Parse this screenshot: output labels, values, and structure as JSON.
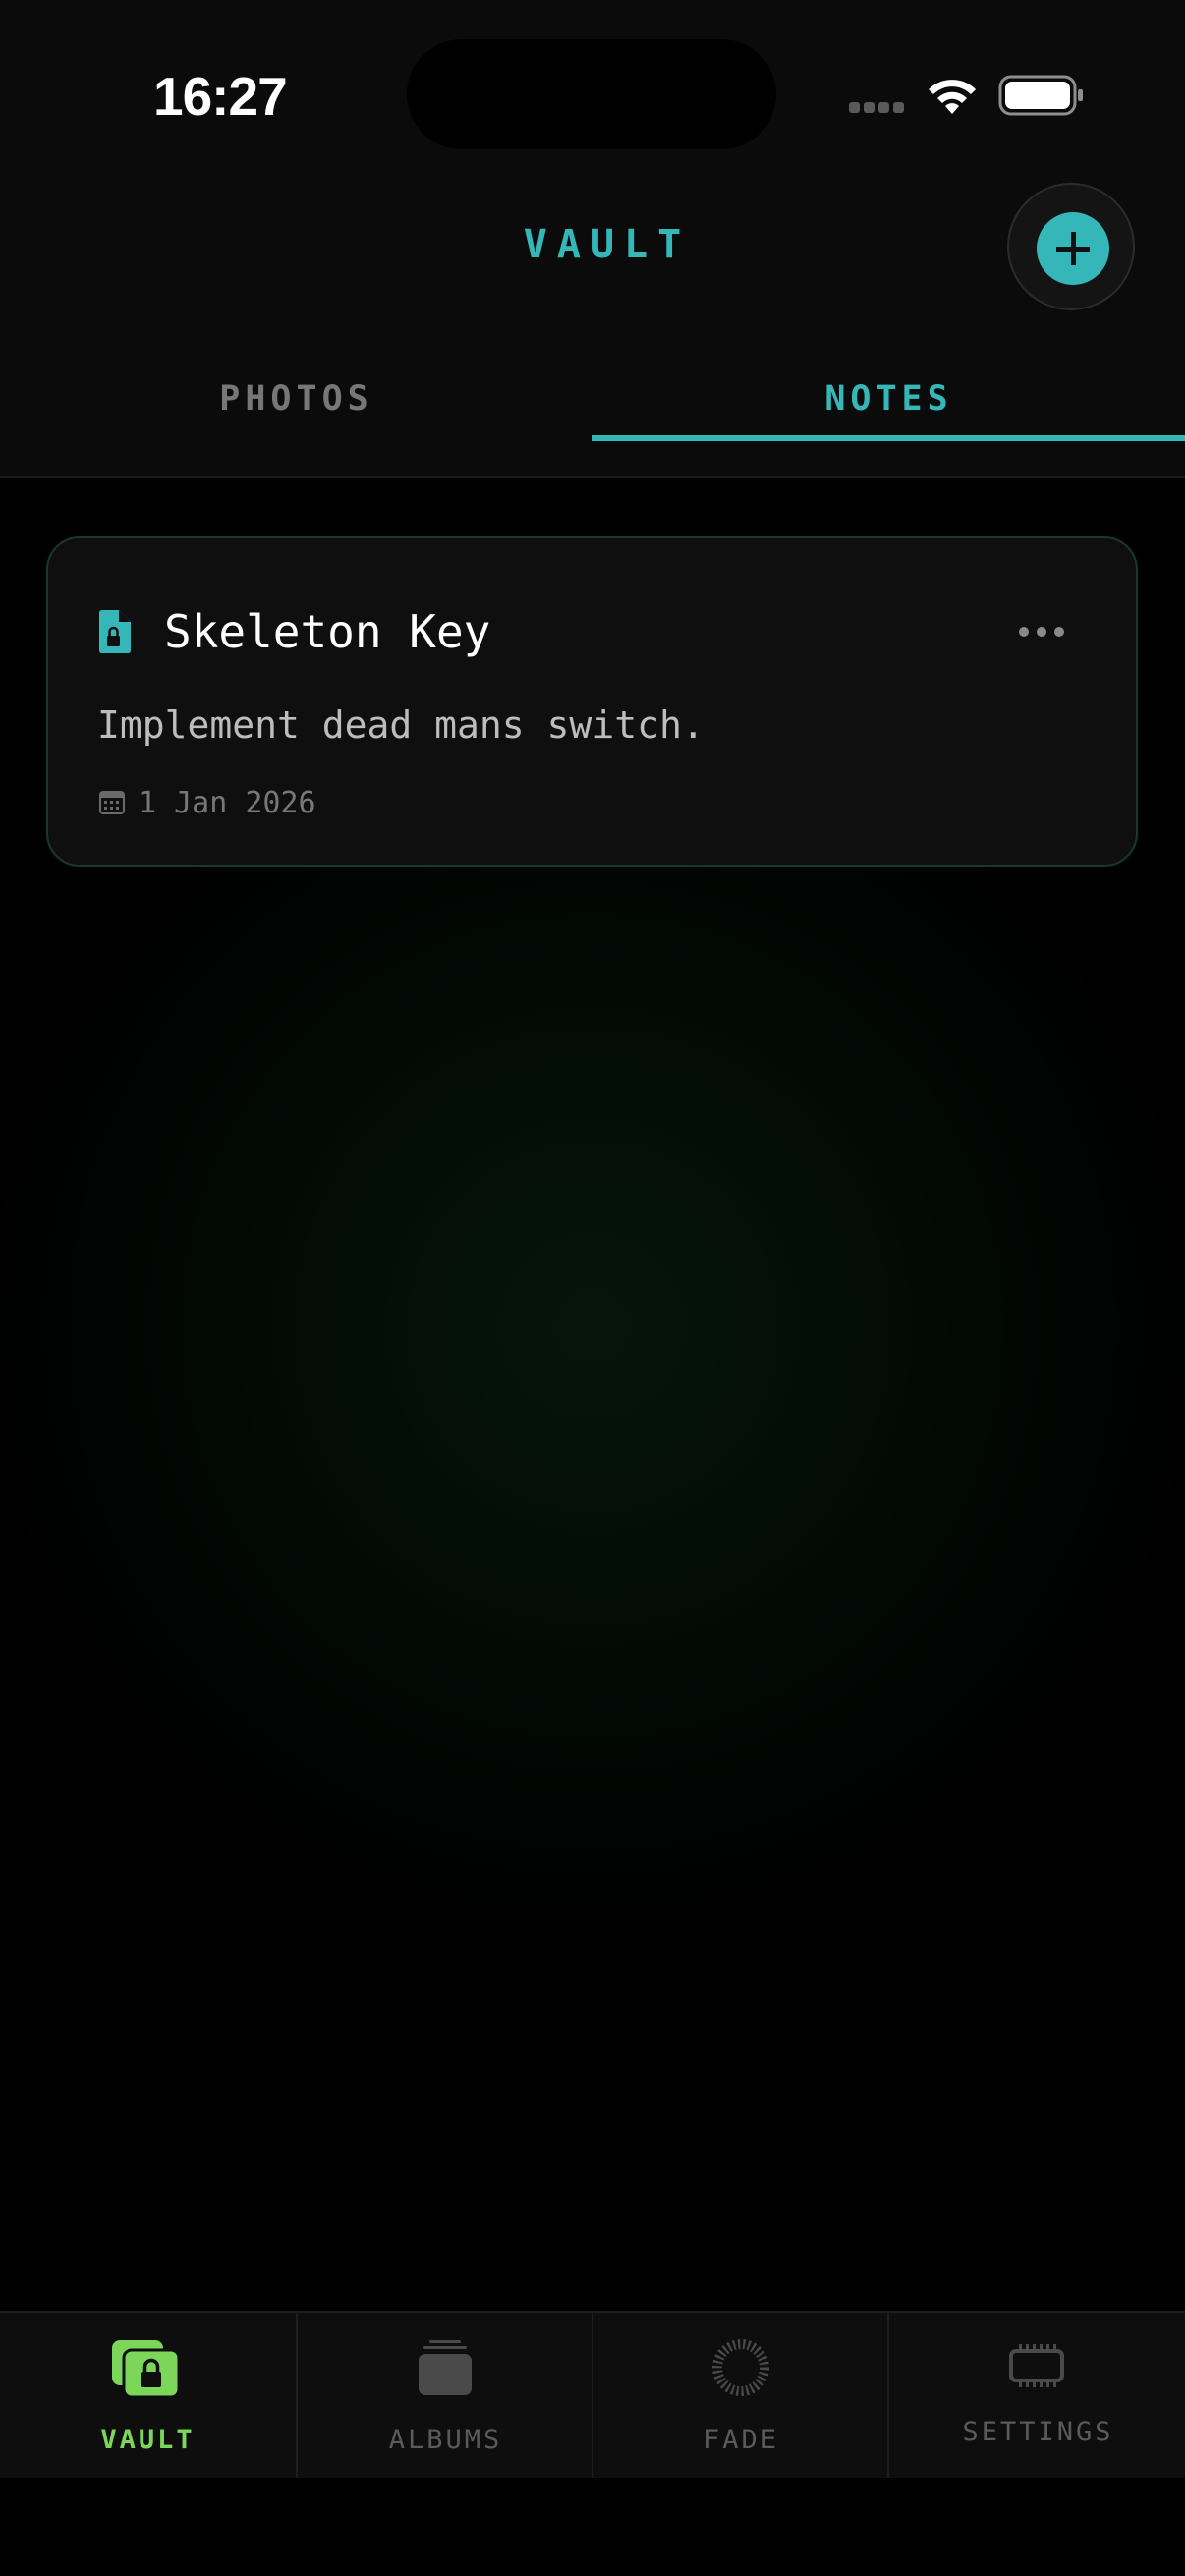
{
  "status_bar": {
    "time": "16:27"
  },
  "header": {
    "title": "VAULT",
    "add_icon": "plus-icon"
  },
  "tabs": [
    {
      "label": "PHOTOS",
      "active": false
    },
    {
      "label": "NOTES",
      "active": true
    }
  ],
  "notes": [
    {
      "title": "Skeleton Key",
      "body": "Implement dead mans switch.",
      "date": "1 Jan 2026",
      "icon": "locked-file-icon"
    }
  ],
  "bottom_nav": [
    {
      "label": "VAULT",
      "icon": "vault-icon",
      "active": true
    },
    {
      "label": "ALBUMS",
      "icon": "albums-icon",
      "active": false
    },
    {
      "label": "FADE",
      "icon": "fade-icon",
      "active": false
    },
    {
      "label": "SETTINGS",
      "icon": "chip-icon",
      "active": false
    }
  ],
  "colors": {
    "accent": "#35b7b9",
    "nav_active": "#7bd65a",
    "background": "#000000"
  }
}
